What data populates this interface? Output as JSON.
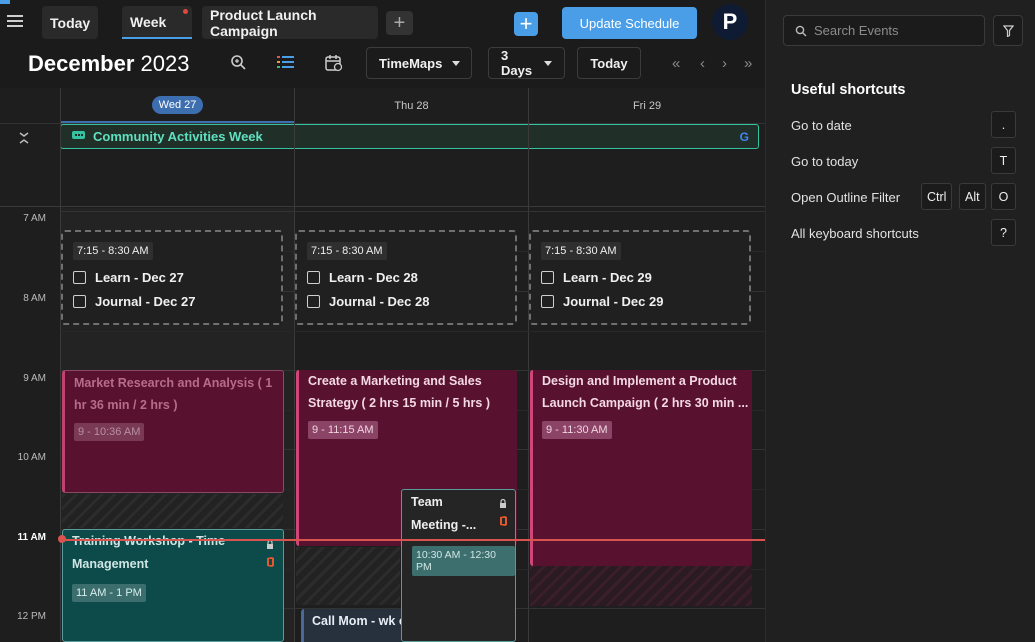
{
  "tabs": [
    {
      "label": "Today"
    },
    {
      "label": "Week"
    },
    {
      "label": "Product Launch Campaign"
    }
  ],
  "add_tab_label": "+",
  "plus_label": "+",
  "update_button": "Update Schedule",
  "avatar_letter": "P",
  "month": "December",
  "year": "2023",
  "view_dropdown": "TimeMaps",
  "days_dropdown": "3 Days",
  "today_button": "Today",
  "nav": {
    "first": "«",
    "prev": "‹",
    "next": "›",
    "last": "»"
  },
  "days": [
    {
      "label": "Wed 27",
      "today": true
    },
    {
      "label": "Thu 28",
      "today": false
    },
    {
      "label": "Fri 29",
      "today": false
    }
  ],
  "all_day_event": {
    "title": "Community Activities Week",
    "source_icon": "G"
  },
  "times": [
    "7 AM",
    "8 AM",
    "9 AM",
    "10 AM",
    "11 AM",
    "12 PM"
  ],
  "current_time_label": "11 AM",
  "task_groups": [
    {
      "time": "7:15 - 8:30 AM",
      "items": [
        "Learn - Dec 27",
        "Journal - Dec 27"
      ]
    },
    {
      "time": "7:15 - 8:30 AM",
      "items": [
        "Learn - Dec 28",
        "Journal - Dec 28"
      ]
    },
    {
      "time": "7:15 - 8:30 AM",
      "items": [
        "Learn - Dec 29",
        "Journal - Dec 29"
      ]
    }
  ],
  "events": {
    "market": {
      "line1": "Market Research and Analysis ( 1",
      "line2": "hr 36 min / 2 hrs )",
      "time": "9 - 10:36 AM"
    },
    "marketing": {
      "line1": "Create a Marketing and Sales",
      "line2": "Strategy ( 2 hrs 15 min / 5 hrs )",
      "time": "9 - 11:15 AM"
    },
    "design": {
      "line1": "Design and Implement a Product",
      "line2": "Launch Campaign ( 2 hrs 30 min ...",
      "time": "9 - 11:30 AM"
    },
    "training": {
      "line1": "Training Workshop - Time",
      "line2": "Management",
      "time": "11 AM - 1 PM"
    },
    "team": {
      "line1": "Team",
      "line2": "Meeting -...",
      "time": "10:30 AM - 12:30 PM"
    },
    "callmom": {
      "title": "Call Mom - wk o"
    }
  },
  "sidebar": {
    "search_placeholder": "Search Events",
    "shortcuts_title": "Useful shortcuts",
    "shortcuts": [
      {
        "label": "Go to date",
        "keys": [
          "."
        ]
      },
      {
        "label": "Go to today",
        "keys": [
          "T"
        ]
      },
      {
        "label": "Open Outline Filter",
        "keys": [
          "Ctrl",
          "Alt",
          "O"
        ]
      },
      {
        "label": "All keyboard shortcuts",
        "keys": [
          "?"
        ]
      }
    ]
  },
  "colors": {
    "accent": "#4a9ee8",
    "event_magenta": "#58112f",
    "event_teal": "#0d4a4a",
    "now_line": "#d9534f",
    "all_day_border": "#35c2a0"
  }
}
